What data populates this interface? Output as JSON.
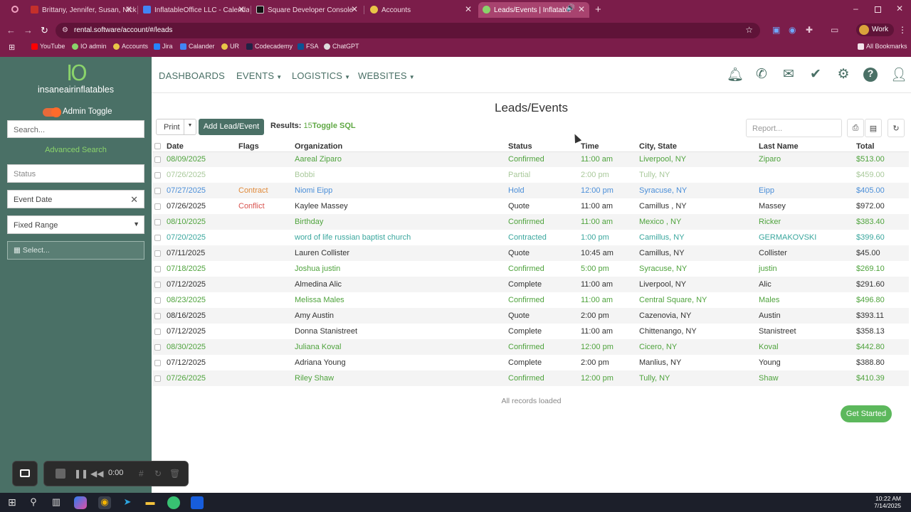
{
  "browser": {
    "tabs": [
      {
        "title": "Brittany, Jennifer, Susan, Nick, ...",
        "fav": "#c4302b"
      },
      {
        "title": "InflatableOffice LLC - Calendar",
        "fav": "#4285f4"
      },
      {
        "title": "Square Developer Console",
        "fav": "#111111"
      },
      {
        "title": "Accounts",
        "fav": "#e8c547"
      },
      {
        "title": "Leads/Events | InflatableOff",
        "fav": "#8ad36b"
      }
    ],
    "url": "rental.software/account/#/leads",
    "profile": "Work",
    "bookmarks": [
      {
        "label": "YouTube",
        "color": "#ff0000"
      },
      {
        "label": "IO admin",
        "color": "#8ad36b"
      },
      {
        "label": "Accounts",
        "color": "#e8c547"
      },
      {
        "label": "Jira",
        "color": "#2684ff"
      },
      {
        "label": "Calander",
        "color": "#4285f4"
      },
      {
        "label": "UR",
        "color": "#e8c547"
      },
      {
        "label": "Codecademy",
        "color": "#222244"
      },
      {
        "label": "FSA",
        "color": "#0b5394"
      },
      {
        "label": "ChatGPT",
        "color": "#dddddd"
      }
    ],
    "all_bookmarks": "All Bookmarks"
  },
  "sidebar": {
    "logo_mark": "IO",
    "logo_name": "insaneairinflatables",
    "admin_toggle": "Admin Toggle",
    "search_placeholder": "Search...",
    "advanced_search": "Advanced Search",
    "status_placeholder": "Status",
    "event_date": "Event Date",
    "fixed_range": "Fixed Range",
    "select_placeholder": "Select..."
  },
  "nav": {
    "dashboards": "DASHBOARDS",
    "events": "EVENTS",
    "logistics": "LOGISTICS",
    "websites": "WEBSITES"
  },
  "page": {
    "title": "Leads/Events",
    "print": "Print",
    "add_lead": "Add Lead/Event",
    "results_label": "Results:",
    "results_count": "15",
    "toggle_sql": "Toggle SQL",
    "report_placeholder": "Report...",
    "all_loaded": "All records loaded",
    "get_started": "Get Started"
  },
  "table": {
    "headers": [
      "Date",
      "Flags",
      "Organization",
      "Status",
      "Time",
      "City, State",
      "Last Name",
      "Total"
    ],
    "rows": [
      {
        "date": "08/09/2025",
        "flag": "",
        "org": "Aareal Ziparo",
        "status": "Confirmed",
        "time": "11:00 am",
        "city": "Liverpool, NY",
        "last": "Ziparo",
        "total": "$513.00"
      },
      {
        "date": "07/26/2025",
        "flag": "",
        "org": "Bobbi",
        "status": "Partial",
        "time": "2:00 pm",
        "city": "Tully, NY",
        "last": "",
        "total": "$459.00"
      },
      {
        "date": "07/27/2025",
        "flag": "Contract",
        "org": "Niomi Eipp",
        "status": "Hold",
        "time": "12:00 pm",
        "city": "Syracuse, NY",
        "last": "Eipp",
        "total": "$405.00"
      },
      {
        "date": "07/26/2025",
        "flag": "Conflict",
        "org": "Kaylee Massey",
        "status": "Quote",
        "time": "11:00 am",
        "city": "Camillus , NY",
        "last": "Massey",
        "total": "$972.00"
      },
      {
        "date": "08/10/2025",
        "flag": "",
        "org": "Birthday",
        "status": "Confirmed",
        "time": "11:00 am",
        "city": "Mexico , NY",
        "last": "Ricker",
        "total": "$383.40"
      },
      {
        "date": "07/20/2025",
        "flag": "",
        "org": "word of life russian baptist church",
        "status": "Contracted",
        "time": "1:00 pm",
        "city": "Camillus, NY",
        "last": "GERMAKOVSKI",
        "total": "$399.60"
      },
      {
        "date": "07/11/2025",
        "flag": "",
        "org": "Lauren Collister",
        "status": "Quote",
        "time": "10:45 am",
        "city": "Camillus, NY",
        "last": "Collister",
        "total": "$45.00"
      },
      {
        "date": "07/18/2025",
        "flag": "",
        "org": "Joshua justin",
        "status": "Confirmed",
        "time": "5:00 pm",
        "city": "Syracuse, NY",
        "last": "justin",
        "total": "$269.10"
      },
      {
        "date": "07/12/2025",
        "flag": "",
        "org": "Almedina Alic",
        "status": "Complete",
        "time": "11:00 am",
        "city": "Liverpool, NY",
        "last": "Alic",
        "total": "$291.60"
      },
      {
        "date": "08/23/2025",
        "flag": "",
        "org": "Melissa Males",
        "status": "Confirmed",
        "time": "11:00 am",
        "city": "Central Square, NY",
        "last": "Males",
        "total": "$496.80"
      },
      {
        "date": "08/16/2025",
        "flag": "",
        "org": "Amy Austin",
        "status": "Quote",
        "time": "2:00 pm",
        "city": "Cazenovia, NY",
        "last": "Austin",
        "total": "$393.11"
      },
      {
        "date": "07/12/2025",
        "flag": "",
        "org": "Donna Stanistreet",
        "status": "Complete",
        "time": "11:00 am",
        "city": "Chittenango, NY",
        "last": "Stanistreet",
        "total": "$358.13"
      },
      {
        "date": "08/30/2025",
        "flag": "",
        "org": "Juliana Koval",
        "status": "Confirmed",
        "time": "12:00 pm",
        "city": "Cicero, NY",
        "last": "Koval",
        "total": "$442.80"
      },
      {
        "date": "07/12/2025",
        "flag": "",
        "org": "Adriana Young",
        "status": "Complete",
        "time": "2:00 pm",
        "city": "Manlius, NY",
        "last": "Young",
        "total": "$388.80"
      },
      {
        "date": "07/26/2025",
        "flag": "",
        "org": "Riley Shaw",
        "status": "Confirmed",
        "time": "12:00 pm",
        "city": "Tully, NY",
        "last": "Shaw",
        "total": "$410.39"
      }
    ]
  },
  "recorder": {
    "time": "0:00"
  },
  "taskbar": {
    "time": "10:22 AM",
    "date": "7/14/2025"
  }
}
